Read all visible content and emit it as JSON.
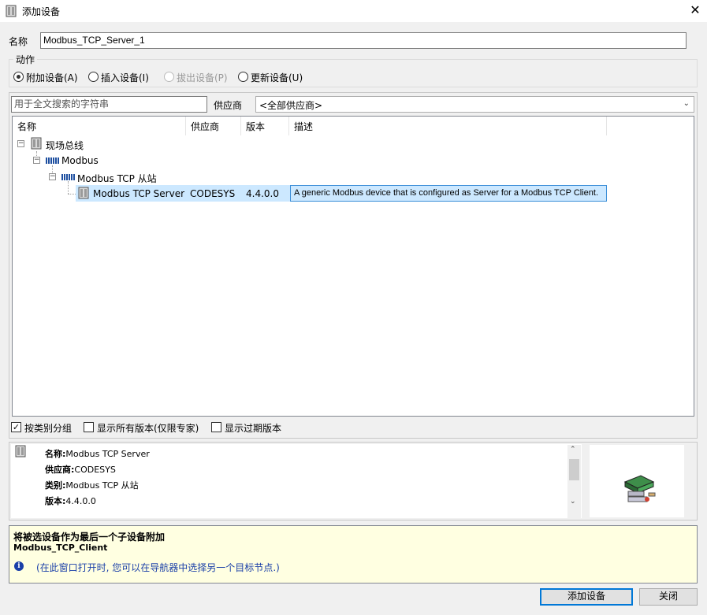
{
  "window": {
    "title": "添加设备",
    "close_glyph": "✕"
  },
  "name_field": {
    "label": "名称",
    "value": "Modbus_TCP_Server_1"
  },
  "action": {
    "group_label": "动作",
    "options": [
      {
        "label": "附加设备(A)",
        "selected": true,
        "enabled": true
      },
      {
        "label": "插入设备(I)",
        "selected": false,
        "enabled": true
      },
      {
        "label": "拔出设备(P)",
        "selected": false,
        "enabled": false
      },
      {
        "label": "更新设备(U)",
        "selected": false,
        "enabled": true
      }
    ]
  },
  "search": {
    "placeholder": "用于全文搜索的字符串",
    "vendor_label": "供应商",
    "vendor_value": "<全部供应商>"
  },
  "device_list": {
    "columns": [
      "名称",
      "供应商",
      "版本",
      "描述"
    ],
    "tree": {
      "root": "现场总线",
      "level1": "Modbus",
      "level2": "Modbus TCP 从站",
      "selected": {
        "name": "Modbus TCP Server",
        "vendor": "CODESYS",
        "version": "4.4.0.0",
        "description": "A generic Modbus device that is configured as Server for a Modbus TCP Client."
      }
    }
  },
  "options": {
    "group_by_category": {
      "label": "按类别分组",
      "checked": true
    },
    "show_all_versions": {
      "label": "显示所有版本(仅限专家)",
      "checked": false
    },
    "show_outdated": {
      "label": "显示过期版本",
      "checked": false
    }
  },
  "info": {
    "name_label": "名称:",
    "name_value": "Modbus TCP Server",
    "vendor_label": "供应商:",
    "vendor_value": "CODESYS",
    "category_label": "类别:",
    "category_value": "Modbus TCP 从站",
    "version_label": "版本:",
    "version_value": "4.4.0.0"
  },
  "hint": {
    "line1": "将被选设备作为最后一个子设备附加",
    "line2": "Modbus_TCP_Client",
    "note": "(在此窗口打开时, 您可以在导航器中选择另一个目标节点.)"
  },
  "buttons": {
    "add": "添加设备",
    "close": "关闭"
  },
  "colors": {
    "selection": "#cce8ff",
    "selection_border": "#3d8fd8",
    "hint_bg": "#ffffe1",
    "info_icon": "#1a3fa8"
  }
}
